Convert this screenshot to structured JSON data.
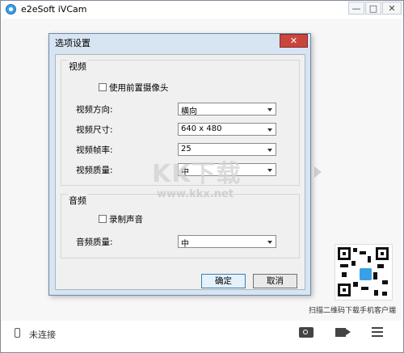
{
  "app": {
    "title": "e2eSoft iVCam"
  },
  "window_buttons": {
    "min": "—",
    "max": "□",
    "close": "✕"
  },
  "status": {
    "connection": "未连接"
  },
  "qr": {
    "caption": "扫描二维码下载手机客户端"
  },
  "watermark": {
    "logo_text": "KK下载",
    "url": "www.kkx.net"
  },
  "dialog": {
    "title": "选项设置",
    "close": "✕",
    "video_group": {
      "title": "视频",
      "use_front_camera": {
        "label": "使用前置摄像头",
        "checked": false
      },
      "rows": [
        {
          "label": "视频方向:",
          "value": "横向"
        },
        {
          "label": "视频尺寸:",
          "value": "640 x 480"
        },
        {
          "label": "视频帧率:",
          "value": "25"
        },
        {
          "label": "视频质量:",
          "value": "中"
        }
      ]
    },
    "audio_group": {
      "title": "音频",
      "record_audio": {
        "label": "录制声音",
        "checked": false
      },
      "quality": {
        "label": "音频质量:",
        "value": "中"
      }
    },
    "ok_label": "确定",
    "cancel_label": "取消"
  },
  "icons": {
    "app": "webcam-icon",
    "status": "phone-icon",
    "snapshot": "camera-icon",
    "record": "video-camera-icon",
    "menu": "hamburger-menu-icon"
  }
}
